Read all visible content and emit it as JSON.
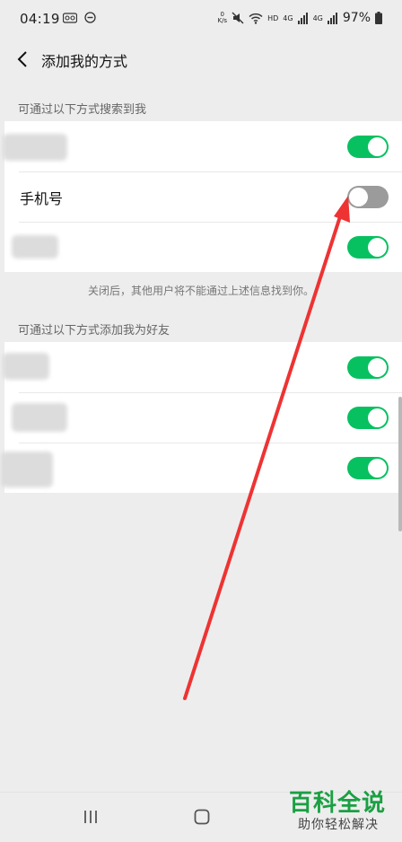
{
  "status_bar": {
    "time": "04:19",
    "net_speed_top": "0",
    "net_speed_unit": "K/s",
    "hd": "HD",
    "signal_4g_1": "4G",
    "signal_4g_2": "4G",
    "battery": "97%",
    "icons": [
      "voicemail-icon",
      "do-not-disturb-icon",
      "mute-icon",
      "wifi-icon",
      "signal-icon",
      "battery-icon"
    ]
  },
  "header": {
    "title": "添加我的方式",
    "back_icon": "chevron-left-icon"
  },
  "search_section": {
    "label": "可通过以下方式搜索到我",
    "rows": [
      {
        "label": "",
        "toggle": "on"
      },
      {
        "label": "手机号",
        "toggle": "off"
      },
      {
        "label": "",
        "toggle": "on"
      }
    ],
    "hint": "关闭后，其他用户将不能通过上述信息找到你。"
  },
  "add_section": {
    "label": "可通过以下方式添加我为好友",
    "rows": [
      {
        "label": "",
        "toggle": "on"
      },
      {
        "label": "",
        "toggle": "on"
      },
      {
        "label": "",
        "toggle": "on"
      }
    ]
  },
  "nav_bar": {
    "buttons": [
      "recent-apps-icon",
      "home-icon",
      "back-icon"
    ]
  },
  "watermark": {
    "main": "百科全说",
    "sub": "助你轻松解决"
  },
  "colors": {
    "toggle_on": "#07c160",
    "toggle_off": "#9b9b9b",
    "annotation_arrow": "#ee3333",
    "watermark_green": "#1aa043"
  }
}
